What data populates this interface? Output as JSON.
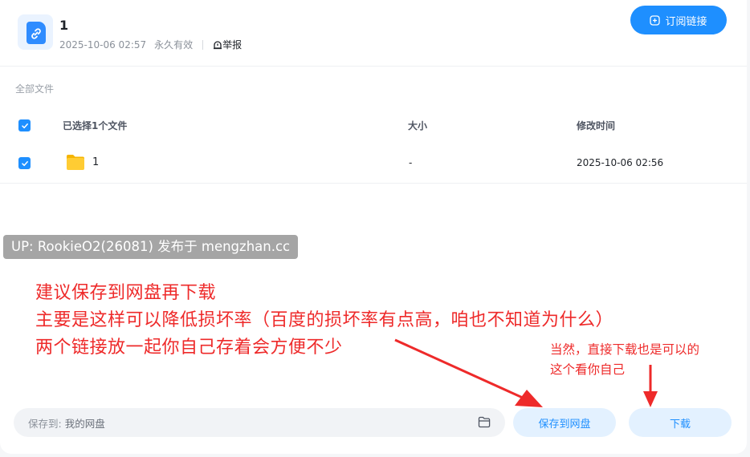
{
  "share": {
    "title": "1",
    "date": "2025-10-06 02:57",
    "validity": "永久有效",
    "report_label": "举报",
    "subscribe_label": "订阅链接"
  },
  "breadcrumb": "全部文件",
  "table": {
    "headers": {
      "name": "已选择1个文件",
      "size": "大小",
      "modified": "修改时间"
    },
    "rows": [
      {
        "name": "1",
        "size": "-",
        "modified": "2025-10-06 02:56",
        "checked": true
      }
    ]
  },
  "overlay": {
    "up_tag": "UP: RookieO2(26081) 发布于 mengzhan.cc",
    "notes": [
      "建议保存到网盘再下载",
      "主要是这样可以降低损坏率（百度的损坏率有点高，咱也不知道为什么）",
      "两个链接放一起你自己存着会方便不少"
    ],
    "small_notes": [
      "当然，直接下载也是可以的",
      "这个看你自己"
    ]
  },
  "bottom": {
    "save_to_label": "保存到:",
    "save_to_path": "我的网盘",
    "save_button": "保存到网盘",
    "download_button": "下载"
  },
  "colors": {
    "accent": "#1e8fff",
    "annotation": "#ee2a2a",
    "tag_bg": "#a5a5a5"
  }
}
